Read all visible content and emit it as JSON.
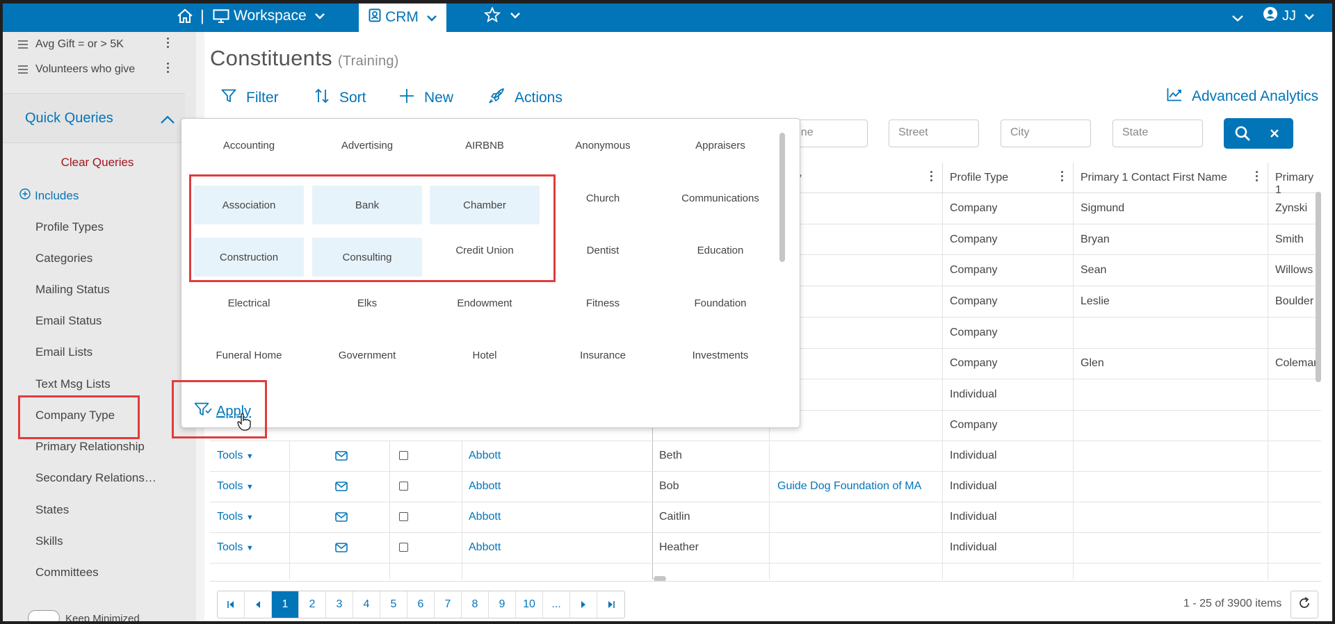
{
  "topbar": {
    "workspace_label": "Workspace",
    "crm_label": "CRM",
    "separator": "|",
    "user_initials": "JJ"
  },
  "sidebar": {
    "saved_queries": [
      {
        "label": "Avg Gift = or > 5K"
      },
      {
        "label": "Volunteers who give"
      }
    ],
    "quick_queries_title": "Quick Queries",
    "clear_queries": "Clear Queries",
    "includes": "Includes",
    "items": [
      {
        "label": "Profile Types"
      },
      {
        "label": "Categories"
      },
      {
        "label": "Mailing Status"
      },
      {
        "label": "Email Status"
      },
      {
        "label": "Email Lists"
      },
      {
        "label": "Text Msg Lists"
      },
      {
        "label": "Company Type"
      },
      {
        "label": "Primary Relationship"
      },
      {
        "label": "Secondary Relations…"
      },
      {
        "label": "States"
      },
      {
        "label": "Skills"
      },
      {
        "label": "Committees"
      }
    ],
    "keep_minimized": "Keep Minimized"
  },
  "page": {
    "title": "Constituents",
    "subtitle": "(Training)"
  },
  "toolbar": {
    "filter": "Filter",
    "sort": "Sort",
    "new": "New",
    "actions": "Actions",
    "advanced_analytics": "Advanced Analytics"
  },
  "search": {
    "phone_partial": "hone",
    "street": "Street",
    "city": "City",
    "state": "State"
  },
  "grid": {
    "headers": {
      "company_partial": "pany",
      "profile_type": "Profile Type",
      "primary_first": "Primary 1 Contact First Name",
      "primary_partial": "Primary 1"
    },
    "top_rows": [
      {
        "profile_type": "Company",
        "first": "Sigmund",
        "last": "Zynski"
      },
      {
        "profile_type": "Company",
        "first": "Bryan",
        "last": "Smith"
      },
      {
        "profile_type": "Company",
        "first": "Sean",
        "last": "Willows"
      },
      {
        "profile_type": "Company",
        "first": "Leslie",
        "last": "Boulder"
      },
      {
        "profile_type": "Company",
        "first": "",
        "last": ""
      },
      {
        "profile_type": "Company",
        "first": "Glen",
        "last": "Coleman"
      },
      {
        "profile_type": "Individual",
        "first": "",
        "last": ""
      },
      {
        "profile_type": "Company",
        "first": "",
        "last": ""
      }
    ],
    "tools_label": "Tools",
    "bottom_rows": [
      {
        "last_name": "Abbott",
        "first_name": "Beth",
        "company": "",
        "profile_type": "Individual"
      },
      {
        "last_name": "Abbott",
        "first_name": "Bob",
        "company": "Guide Dog Foundation of MA",
        "profile_type": "Individual"
      },
      {
        "last_name": "Abbott",
        "first_name": "Caitlin",
        "company": "",
        "profile_type": "Individual"
      },
      {
        "last_name": "Abbott",
        "first_name": "Heather",
        "company": "",
        "profile_type": "Individual"
      }
    ]
  },
  "pager": {
    "pages": [
      "1",
      "2",
      "3",
      "4",
      "5",
      "6",
      "7",
      "8",
      "9",
      "10",
      "..."
    ],
    "active": "1",
    "items_info": "1 - 25 of 3900 items"
  },
  "popup": {
    "options": [
      {
        "label": "Accounting",
        "selected": false
      },
      {
        "label": "Advertising",
        "selected": false
      },
      {
        "label": "AIRBNB",
        "selected": false
      },
      {
        "label": "Anonymous",
        "selected": false
      },
      {
        "label": "Appraisers",
        "selected": false
      },
      {
        "label": "Association",
        "selected": true
      },
      {
        "label": "Bank",
        "selected": true
      },
      {
        "label": "Chamber",
        "selected": true
      },
      {
        "label": "Church",
        "selected": false
      },
      {
        "label": "Communications",
        "selected": false
      },
      {
        "label": "Construction",
        "selected": true
      },
      {
        "label": "Consulting",
        "selected": true
      },
      {
        "label": "Credit Union",
        "selected": false
      },
      {
        "label": "Dentist",
        "selected": false
      },
      {
        "label": "Education",
        "selected": false
      },
      {
        "label": "Electrical",
        "selected": false
      },
      {
        "label": "Elks",
        "selected": false
      },
      {
        "label": "Endowment",
        "selected": false
      },
      {
        "label": "Fitness",
        "selected": false
      },
      {
        "label": "Foundation",
        "selected": false
      },
      {
        "label": "Funeral Home",
        "selected": false
      },
      {
        "label": "Government",
        "selected": false
      },
      {
        "label": "Hotel",
        "selected": false
      },
      {
        "label": "Insurance",
        "selected": false
      },
      {
        "label": "Investments",
        "selected": false
      }
    ],
    "apply": "Apply"
  },
  "colors": {
    "brand": "#0275b8",
    "selected_bg": "#e6f3fb",
    "highlight": "#e03c3c",
    "clear_queries": "#a0141e"
  }
}
